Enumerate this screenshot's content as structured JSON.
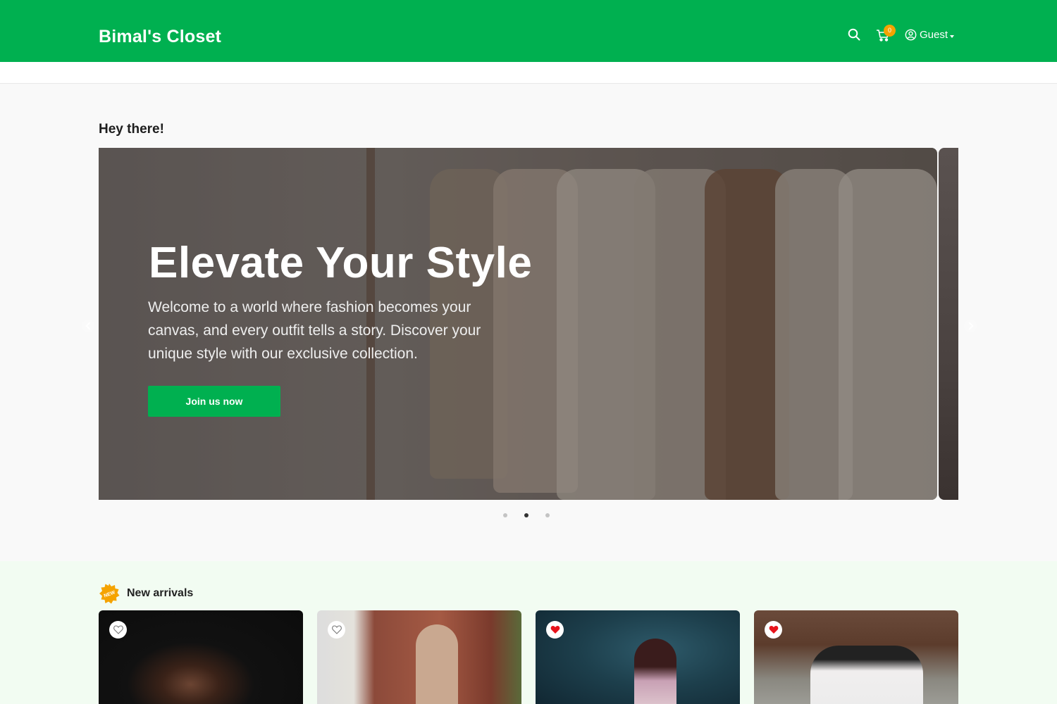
{
  "header": {
    "brand": "Bimal's Closet",
    "cart_count": "0",
    "user_label": "Guest",
    "colors": {
      "brand_green": "#00b050",
      "badge": "#f5a300"
    }
  },
  "main": {
    "greeting": "Hey there!",
    "hero": {
      "title": "Elevate Your Style",
      "text": "Welcome to a world where fashion becomes your canvas, and every outfit tells a story. Discover your unique style with our exclusive collection.",
      "cta_label": "Join us now"
    },
    "carousel": {
      "slide_count": 3,
      "active_index": 1
    }
  },
  "arrivals": {
    "badge_text": "NEW",
    "title": "New arrivals",
    "products": [
      {
        "favorite": false,
        "icon": "heart-outline-icon"
      },
      {
        "favorite": false,
        "icon": "heart-outline-icon"
      },
      {
        "favorite": true,
        "icon": "heart-filled-icon"
      },
      {
        "favorite": true,
        "icon": "heart-filled-icon"
      }
    ]
  }
}
